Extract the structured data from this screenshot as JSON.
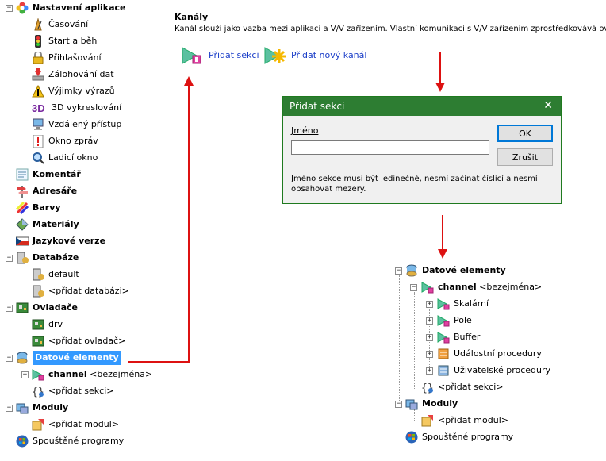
{
  "left_tree": {
    "settings": {
      "label": "Nastavení aplikace",
      "children": [
        "Časování",
        "Start a běh",
        "Přihlašování",
        "Zálohování dat",
        "Výjimky výrazů",
        "3D vykreslování",
        "Vzdálený přístup",
        "Okno zpráv",
        "Ladicí okno"
      ]
    },
    "comment": "Komentář",
    "addresses": "Adresáře",
    "colors": "Barvy",
    "materials": "Materiály",
    "languages": "Jazykové verze",
    "databases": {
      "label": "Databáze",
      "children": [
        "default",
        "<přidat databázi>"
      ]
    },
    "drivers": {
      "label": "Ovladače",
      "children": [
        "drv",
        "<přidat ovladač>"
      ]
    },
    "data_elements": {
      "label": "Datové elementy",
      "channel_label": "channel",
      "channel_suffix": "<bezejména>",
      "add_section": "<přidat sekci>"
    },
    "modules": {
      "label": "Moduly",
      "add_module": "<přidat modul>"
    },
    "programs": "Spouštěné programy"
  },
  "channels_panel": {
    "title": "Kanály",
    "description": "Kanál slouží jako vazba mezi aplikací a V/V zařízením. Vlastní komunikaci s V/V zařízením zprostředkovává ovladač.",
    "add_section_link": "Přidat sekci",
    "add_channel_link": "Přidat nový kanál"
  },
  "dialog": {
    "title": "Přidat sekci",
    "name_label": "Jméno",
    "name_value": "",
    "ok_label": "OK",
    "cancel_label": "Zrušit",
    "close_symbol": "✕",
    "hint": "Jméno sekce musí být jedinečné, nesmí začínat číslicí a nesmí obsahovat mezery."
  },
  "result_tree": {
    "data_elements": "Datové elementy",
    "channel_label": "channel",
    "channel_suffix": "<bezejména>",
    "sections": [
      "Skalární",
      "Pole",
      "Buffer",
      "Událostní procedury",
      "Uživatelské procedury"
    ],
    "add_section": "<přidat sekci>",
    "modules": "Moduly",
    "add_module": "<přidat modul>",
    "programs": "Spouštěné programy"
  },
  "colors": {
    "arrow": "#dd1111",
    "selection": "#3399ff",
    "dialog_title_bar": "#2d7d32",
    "link": "#1a3dc8"
  }
}
